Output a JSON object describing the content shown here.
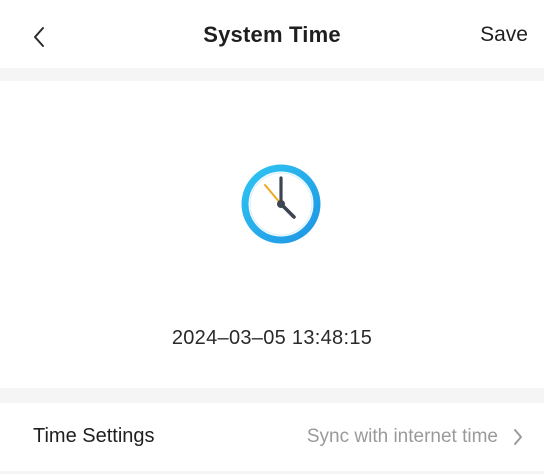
{
  "header": {
    "title": "System Time",
    "save_label": "Save"
  },
  "clock": {
    "datetime": "2024–03–05 13:48:15",
    "icon": "clock-icon",
    "accent_color": "#21a9ea",
    "hand_color": "#3d4452",
    "second_hand_color": "#f0a91f"
  },
  "settings": {
    "label": "Time Settings",
    "value": "Sync with internet time",
    "chevron_icon": "chevron-right-icon"
  },
  "icons": {
    "back": "chevron-left-icon"
  }
}
